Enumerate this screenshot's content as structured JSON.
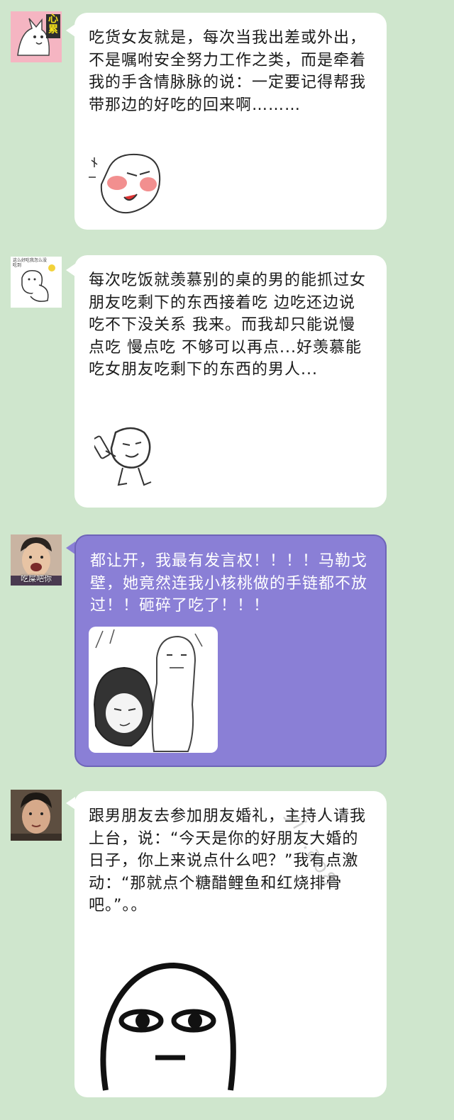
{
  "messages": [
    {
      "avatar_label": "心累",
      "text": "吃货女友就是，每次当我出差或外出，不是嘱咐安全努力工作之类，而是牵着我的手含情脉脉的说：一定要记得帮我带那边的好吃的回来啊………",
      "sticker": "blushing-meme-sticker"
    },
    {
      "avatar_label": "这么好吃我怎么没吃到",
      "text": "每次吃饭就羡慕别的桌的男的能抓过女朋友吃剩下的东西接着吃 边吃还边说 吃不下没关系 我来。而我却只能说慢点吃 慢点吃 不够可以再点...好羡慕能吃女朋友吃剩下的东西的男人...",
      "sticker": "fan-waving-meme-sticker"
    },
    {
      "avatar_label": "吃屎吧你",
      "text": "都让开，我最有发言权！！！！马勒戈壁，她竟然连我小核桃做的手链都不放过！！砸碎了吃了！！！",
      "sticker": "sketch-couple-sticker",
      "bubble_color": "#8a7fd6"
    },
    {
      "avatar_label": "",
      "text": "跟男朋友去参加朋友婚礼，主持人请我上台，说：“今天是你的好朋友大婚的日子，你上来说点什么吧？”我有点激动：“那就点个糖醋鲤鱼和红烧排骨吧。”。。",
      "sticker": "blank-face-meme-sticker"
    }
  ],
  "watermark": "yi...ao8"
}
